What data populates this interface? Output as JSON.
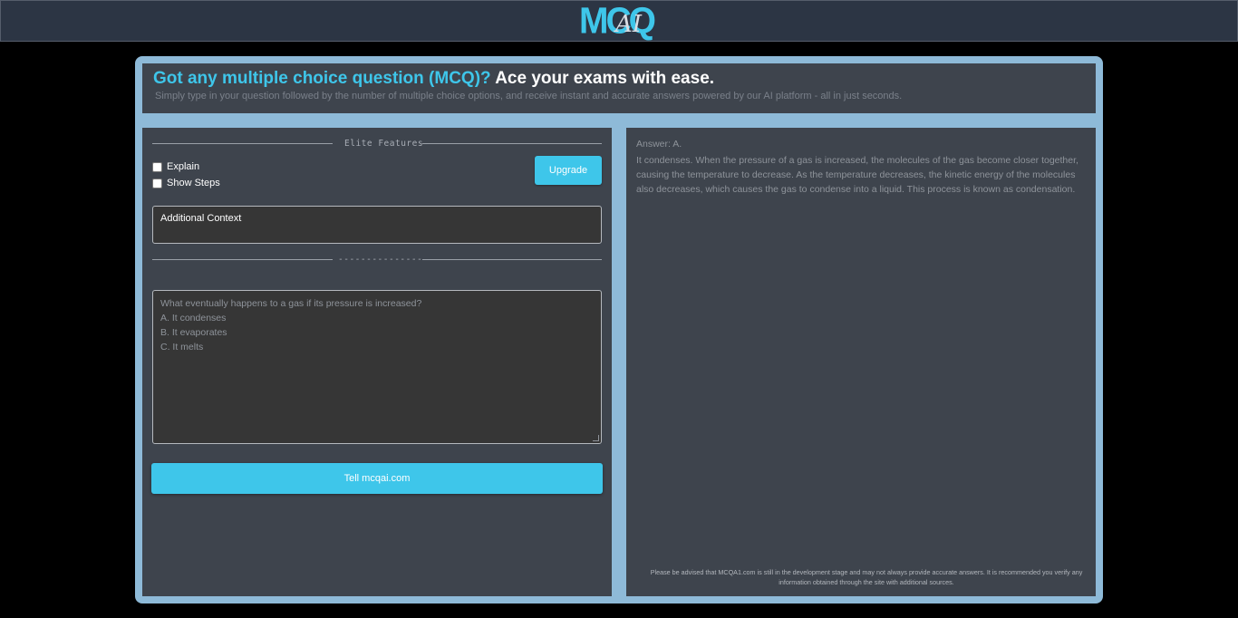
{
  "brand": {
    "logo_main": "MCQ",
    "logo_suffix": "AI"
  },
  "header": {
    "title_accent": "Got any multiple choice question (MCQ)?",
    "title_rest": " Ace your exams with ease.",
    "subtitle": "Simply type in your question followed by the number of multiple choice options, and receive instant and accurate answers powered by our AI platform - all in just seconds."
  },
  "features": {
    "divider_label": "Elite Features",
    "explain_label": "Explain",
    "show_steps_label": "Show Steps",
    "upgrade_label": "Upgrade",
    "context_value": "Additional Context",
    "separator_label": "---------------"
  },
  "question": {
    "lines": [
      "What eventually happens to a gas if its pressure is increased?",
      "A. It condenses",
      "B. It evaporates",
      "C. It melts"
    ],
    "submit_label": "Tell mcqai.com"
  },
  "answer": {
    "label": "Answer: A.",
    "text": "It condenses. When the pressure of a gas is increased, the molecules of the gas become closer together, causing the temperature to decrease. As the temperature decreases, the kinetic energy of the molecules also decreases, which causes the gas to condense into a liquid. This process is known as condensation.",
    "disclaimer": "Please be advised that MCQA1.com is still in the development stage and may not always provide accurate answers. It is recommended you verify any information obtained through the site with additional sources."
  },
  "colors": {
    "accent": "#3ec6ea",
    "frame": "#8ebad8",
    "panel": "#3e444d"
  }
}
